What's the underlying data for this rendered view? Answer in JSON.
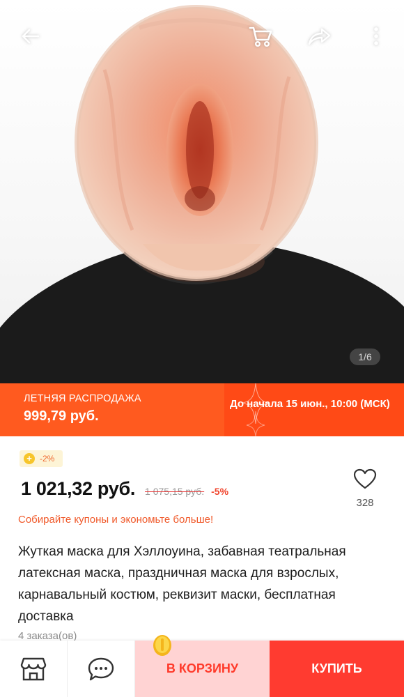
{
  "gallery": {
    "page_counter": "1/6"
  },
  "sale": {
    "title": "ЛЕТНЯЯ РАСПРОДАЖА",
    "price": "999,79 руб.",
    "countdown": "До начала 15 июн., 10:00 (МСК)"
  },
  "product": {
    "coin_badge": "-2%",
    "price": "1 021,32 руб.",
    "old_price": "1 075,15 руб.",
    "discount": "-5%",
    "wishlist_count": "328",
    "coupon_text": "Собирайте купоны и экономьте больше!",
    "title": "Жуткая маска для Хэллоуина, забавная театральная латексная маска, праздничная маска для взрослых, карнавальный костюм, реквизит маски, бесплатная доставка",
    "orders": "4 заказа(ов)"
  },
  "actions": {
    "add_to_cart": "В КОРЗИНУ",
    "buy": "КУПИТЬ"
  },
  "colors": {
    "sale_orange": "#ff5a1f",
    "cart_pink": "#ffd3d3",
    "buy_red": "#ff3b30",
    "coupon_orange": "#f0592a"
  }
}
